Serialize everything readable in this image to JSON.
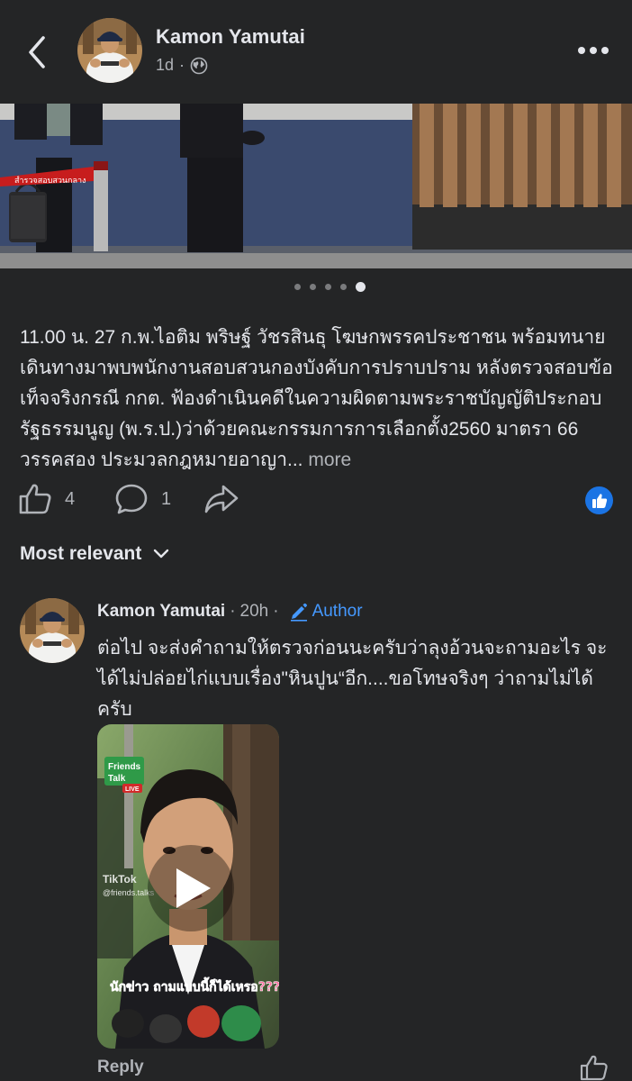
{
  "header": {
    "author_name": "Kamon Yamutai",
    "time_ago": "1d",
    "separator": "·",
    "privacy_icon": "globe-icon"
  },
  "carousel": {
    "sign_text": "สำรวจสอบสวนกลาง",
    "total": 5,
    "active_index": 4
  },
  "post": {
    "caption": "11.00 น. 27 ก.พ.ไอติม พริษฐ์ วัชรสินธุ โฆษกพรรคประชาชน พร้อมทนาย เดินทางมาพบพนักงานสอบสวนกองบังคับการปราบปราม หลังตรวจสอบข้อเท็จจริงกรณี กกต. ฟ้องดำเนินคดีในความผิดตามพระราชบัญญัติประกอบรัฐธรรมนูญ (พ.ร.ป.)ว่าด้วยคณะกรรมการการเลือกตั้ง2560 มาตรา 66 วรรคสอง ประมวลกฎหมายอาญา...",
    "more_label": "more",
    "like_count": "4",
    "comment_count": "1"
  },
  "comments_sort": {
    "label": "Most relevant"
  },
  "comment": {
    "author_name": "Kamon Yamutai",
    "separator": "·",
    "time_ago": "20h",
    "badge": "Author",
    "text": "ต่อไป จะส่งคำถามให้ตรวจก่อนนะครับว่าลุงอ้วนจะถามอะไร จะได้ไม่ปล่อยไก่แบบเรื่อง\"หินปูน“อีก....ขอโทษจริงๆ ว่าถามไม่ได้ครับ",
    "reply_label": "Reply",
    "video": {
      "brand_line1": "Friends",
      "brand_line2": "Talk",
      "live_tag": "LIVE",
      "tiktok_label": "TikTok",
      "handle": "@friends.talks",
      "caption": "นักข่าว ถามแบบนี้ก็ได้เหรอ????"
    }
  },
  "colors": {
    "background": "#242526",
    "text_primary": "#e4e6eb",
    "text_secondary": "#b0b3b8",
    "accent_blue": "#1b74e4",
    "author_blue": "#4599ff"
  }
}
